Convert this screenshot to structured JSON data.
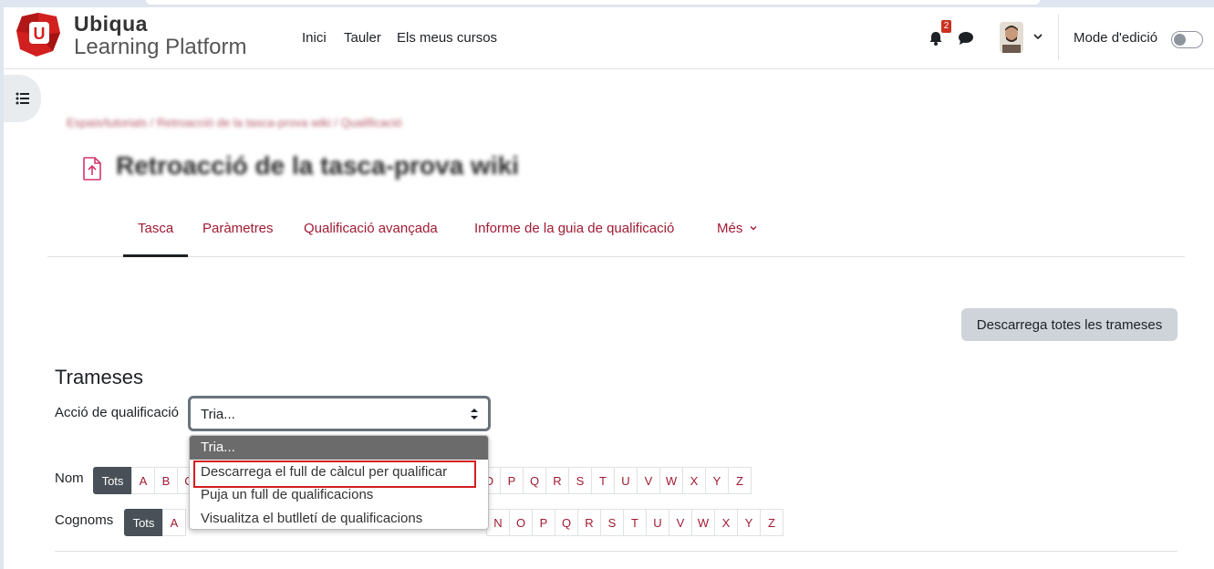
{
  "brand": {
    "line1": "Ubiqua",
    "line2": "Learning Platform"
  },
  "nav": {
    "links": [
      "Inici",
      "Tauler",
      "Els meus cursos"
    ]
  },
  "notifications": {
    "count": "2"
  },
  "edit_mode": {
    "label": "Mode d'edició",
    "enabled": false
  },
  "breadcrumb": "Espais/tutorials / Retroacció de la tasca-prova wiki / Qualificació",
  "page_title": "Retroacció de la tasca-prova wiki",
  "tabs": [
    {
      "label": "Tasca",
      "active": true
    },
    {
      "label": "Paràmetres",
      "active": false
    },
    {
      "label": "Qualificació avançada",
      "active": false
    },
    {
      "label": "Informe de la guia de qualificació",
      "active": false
    },
    {
      "label": "Més",
      "active": false
    }
  ],
  "download_all_label": "Descarrega totes les trameses",
  "section_title": "Trameses",
  "grading_action": {
    "label": "Acció de qualificació",
    "value": "Tria...",
    "options": [
      "Tria...",
      "Descarrega el full de càlcul per qualificar",
      "Puja un full de qualificacions",
      "Visualitza el butlletí de qualificacions"
    ],
    "highlighted_option": "Descarrega el full de càlcul per qualificar"
  },
  "initials": {
    "first_name_label": "Nom",
    "last_name_label": "Cognoms",
    "all_label": "Tots",
    "first_name_visible_left": [
      "A",
      "B",
      "C"
    ],
    "first_name_visible_right": [
      "O",
      "P",
      "Q",
      "R",
      "S",
      "T",
      "U",
      "V",
      "W",
      "X",
      "Y",
      "Z"
    ],
    "last_name_visible_left": [
      "A"
    ],
    "last_name_visible_right": [
      "N",
      "O",
      "P",
      "Q",
      "R",
      "S",
      "T",
      "U",
      "V",
      "W",
      "X",
      "Y",
      "Z"
    ]
  },
  "colors": {
    "accent": "#a11b33",
    "brand_red": "#d21f1f",
    "highlight_border": "#d21f1f"
  }
}
